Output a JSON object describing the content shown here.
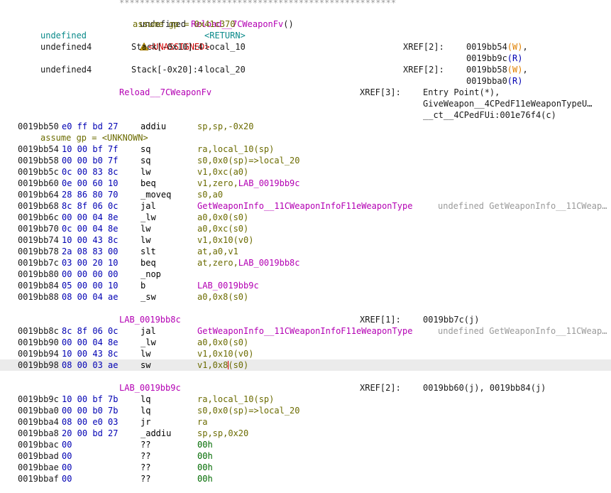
{
  "header": {
    "stars": "******************************************************",
    "signature_type": "undefined",
    "signature_name": "Reload__7CWeaponFv",
    "signature_parens": "()",
    "assume_top": "assume gp = 0x41c370",
    "ret_type": "undefined",
    "unassigned": "<UNASSIGNED>",
    "return_label": "<RETURN>",
    "vars": [
      {
        "type": "undefined4",
        "storage": "Stack[-0x10]:4",
        "name": "local_10",
        "xref_key": "XREF[2]:",
        "xref_addr1": "0019bb54",
        "xref_mode1": "(W)",
        "xref_addr2": "0019bb9c",
        "xref_mode2": "(R)",
        "sep1": ","
      },
      {
        "type": "undefined4",
        "storage": "Stack[-0x20]:4",
        "name": "local_20",
        "xref_key": "XREF[2]:",
        "xref_addr1": "0019bb58",
        "xref_mode1": "(W)",
        "xref_addr2": "0019bba0",
        "xref_mode2": "(R)",
        "sep1": ","
      }
    ],
    "func_label": "Reload__7CWeaponFv",
    "func_xref_key": "XREF[3]:",
    "func_xrefs": [
      "Entry Point(*),",
      "GiveWeapon__4CPedF11eWeaponTypeU…",
      "__ct__4CPedFUi:001e76f4(c)"
    ]
  },
  "listing": [
    {
      "addr": "0019bb50",
      "bytes": "e0 ff bd 27",
      "mn": "addiu",
      "ops": "sp,sp,-0x20"
    },
    {
      "assume": "assume gp = <UNKNOWN>"
    },
    {
      "addr": "0019bb54",
      "bytes": "10 00 bf 7f",
      "mn": "sq",
      "ops": "ra,local_10(sp)"
    },
    {
      "addr": "0019bb58",
      "bytes": "00 00 b0 7f",
      "mn": "sq",
      "ops": "s0,0x0(sp)=>local_20"
    },
    {
      "addr": "0019bb5c",
      "bytes": "0c 00 83 8c",
      "mn": "lw",
      "ops": "v1,0xc(a0)"
    },
    {
      "addr": "0019bb60",
      "bytes": "0e 00 60 10",
      "mn": "beq",
      "ops": "v1,zero,LAB_0019bb9c"
    },
    {
      "addr": "0019bb64",
      "bytes": "28 86 80 70",
      "mn": "_moveq",
      "ops": "s0,a0"
    },
    {
      "addr": "0019bb68",
      "bytes": "8c 8f 06 0c",
      "mn": "jal",
      "ops": "GetWeaponInfo__11CWeaponInfoF11eWeaponType",
      "comment": "undefined GetWeaponInfo__11CWeap…"
    },
    {
      "addr": "0019bb6c",
      "bytes": "00 00 04 8e",
      "mn": "_lw",
      "ops": "a0,0x0(s0)"
    },
    {
      "addr": "0019bb70",
      "bytes": "0c 00 04 8e",
      "mn": "lw",
      "ops": "a0,0xc(s0)"
    },
    {
      "addr": "0019bb74",
      "bytes": "10 00 43 8c",
      "mn": "lw",
      "ops": "v1,0x10(v0)"
    },
    {
      "addr": "0019bb78",
      "bytes": "2a 08 83 00",
      "mn": "slt",
      "ops": "at,a0,v1"
    },
    {
      "addr": "0019bb7c",
      "bytes": "03 00 20 10",
      "mn": "beq",
      "ops": "at,zero,LAB_0019bb8c"
    },
    {
      "addr": "0019bb80",
      "bytes": "00 00 00 00",
      "mn": "_nop",
      "ops": ""
    },
    {
      "addr": "0019bb84",
      "bytes": "05 00 00 10",
      "mn": "b",
      "ops": "LAB_0019bb9c"
    },
    {
      "addr": "0019bb88",
      "bytes": "08 00 04 ae",
      "mn": "_sw",
      "ops": "a0,0x8(s0)"
    },
    {
      "label": "LAB_0019bb8c",
      "xref_key": "XREF[1]:",
      "xref": "0019bb7c(j)"
    },
    {
      "addr": "0019bb8c",
      "bytes": "8c 8f 06 0c",
      "mn": "jal",
      "ops": "GetWeaponInfo__11CWeaponInfoF11eWeaponType",
      "comment": "undefined GetWeaponInfo__11CWeap…"
    },
    {
      "addr": "0019bb90",
      "bytes": "00 00 04 8e",
      "mn": "_lw",
      "ops": "a0,0x0(s0)"
    },
    {
      "addr": "0019bb94",
      "bytes": "10 00 43 8c",
      "mn": "lw",
      "ops": "v1,0x10(v0)"
    },
    {
      "addr": "0019bb98",
      "bytes": "08 00 03 ae",
      "mn": "sw",
      "ops_a": "v1,0x8",
      "ops_b": "(s0)"
    },
    {
      "label": "LAB_0019bb9c",
      "xref_key": "XREF[2]:",
      "xref": "0019bb60(j), 0019bb84(j)"
    },
    {
      "addr": "0019bb9c",
      "bytes": "10 00 bf 7b",
      "mn": "lq",
      "ops": "ra,local_10(sp)"
    },
    {
      "addr": "0019bba0",
      "bytes": "00 00 b0 7b",
      "mn": "lq",
      "ops": "s0,0x0(sp)=>local_20"
    },
    {
      "addr": "0019bba4",
      "bytes": "08 00 e0 03",
      "mn": "jr",
      "ops": "ra"
    },
    {
      "addr": "0019bba8",
      "bytes": "20 00 bd 27",
      "mn": "_addiu",
      "ops": "sp,sp,0x20"
    },
    {
      "addr": "0019bbac",
      "bytes": "00",
      "mn": "??",
      "ops": "00h"
    },
    {
      "addr": "0019bbad",
      "bytes": "00",
      "mn": "??",
      "ops": "00h"
    },
    {
      "addr": "0019bbae",
      "bytes": "00",
      "mn": "??",
      "ops": "00h"
    },
    {
      "addr": "0019bbaf",
      "bytes": "00",
      "mn": "??",
      "ops": "00h"
    }
  ],
  "icons": {
    "warning": "warning-icon",
    "cursor": "text-cursor-icon"
  },
  "colors": {
    "label": "#b300b3",
    "bytes": "#0000b3",
    "operands": "#6b6b00",
    "write": "#e08000",
    "read": "#0000b3",
    "unassigned": "#d40000",
    "hex_values": "#006b00",
    "type": "#0a8a8a",
    "comment": "#9a9a9a",
    "highlight": "#ebebeb"
  }
}
